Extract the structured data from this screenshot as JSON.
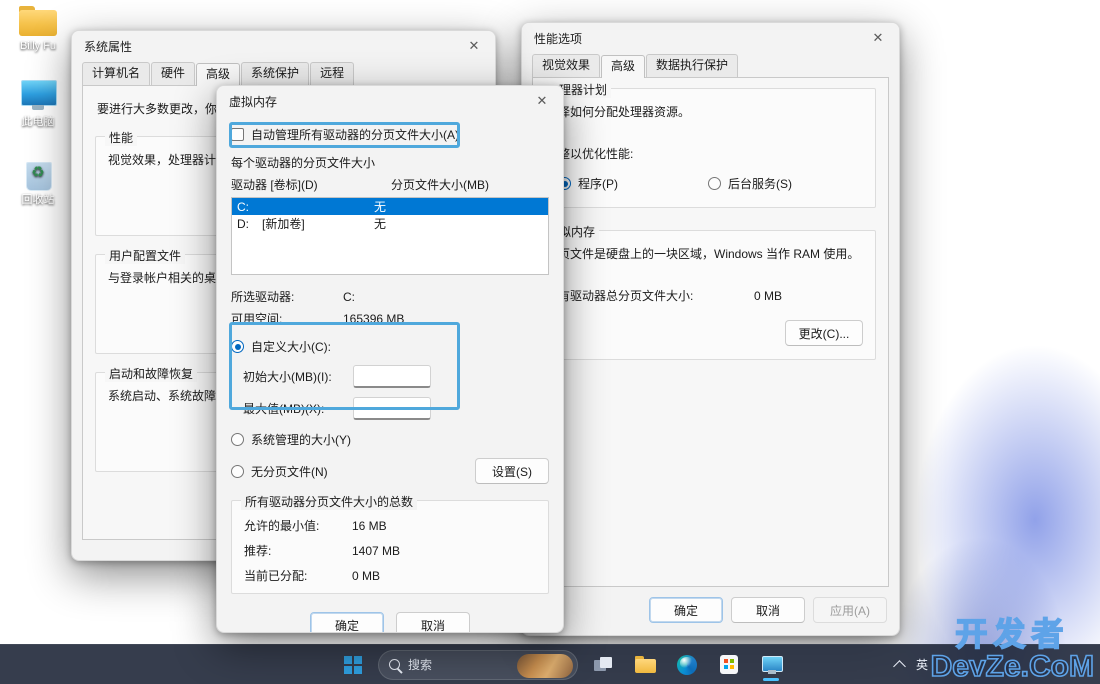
{
  "desktop": {
    "icons": [
      {
        "label": "Billy Fu",
        "icon": "folder-icon"
      },
      {
        "label": "此电脑",
        "icon": "this-pc-icon"
      },
      {
        "label": "回收站",
        "icon": "recycle-bin-icon"
      }
    ],
    "watermark_line1": "开发者",
    "watermark_line2": "DevZe.CoM"
  },
  "system_properties": {
    "title": "系统属性",
    "close_label": "✕",
    "tabs": [
      {
        "label": "计算机名",
        "active": false
      },
      {
        "label": "硬件",
        "active": false
      },
      {
        "label": "高级",
        "active": true
      },
      {
        "label": "系统保护",
        "active": false
      },
      {
        "label": "远程",
        "active": false
      }
    ],
    "intro": "要进行大多数更改，你必",
    "groups": [
      {
        "legend": "性能",
        "desc": "视觉效果，处理器计划，"
      },
      {
        "legend": "用户配置文件",
        "desc": "与登录帐户相关的桌面设"
      },
      {
        "legend": "启动和故障恢复",
        "desc": "系统启动、系统故障和调"
      }
    ]
  },
  "performance_options": {
    "title": "性能选项",
    "close_label": "✕",
    "tabs": [
      {
        "label": "视觉效果",
        "active": false
      },
      {
        "label": "高级",
        "active": true
      },
      {
        "label": "数据执行保护",
        "active": false
      }
    ],
    "processor_group": {
      "legend": "理器计划",
      "desc": "择如何分配处理器资源。",
      "adjust_label": "整以优化性能:",
      "radio_programs": "程序(P)",
      "radio_services": "后台服务(S)",
      "programs_selected": true,
      "services_selected": false
    },
    "virtual_memory_group": {
      "legend": "拟内存",
      "desc": "页文件是硬盘上的一块区域，Windows 当作 RAM 使用。",
      "total_label": "有驱动器总分页文件大小:",
      "total_value": "0 MB",
      "change_button": "更改(C)..."
    },
    "footer_buttons": [
      {
        "label": "确定",
        "style": "default",
        "disabled": false
      },
      {
        "label": "取消",
        "style": "normal",
        "disabled": false
      },
      {
        "label": "应用(A)",
        "style": "normal",
        "disabled": true
      }
    ]
  },
  "virtual_memory": {
    "title": "虚拟内存",
    "close_label": "✕",
    "auto_manage": {
      "label": "自动管理所有驱动器的分页文件大小(A)",
      "checked": false,
      "highlighted": true
    },
    "per_drive": {
      "legend": "每个驱动器的分页文件大小",
      "columns": [
        "驱动器 [卷标](D)",
        "分页文件大小(MB)"
      ],
      "rows": [
        {
          "drive": "C:",
          "volume": "",
          "size": "无",
          "selected": true
        },
        {
          "drive": "D:",
          "volume": "[新加卷]",
          "size": "无",
          "selected": false
        }
      ]
    },
    "selected_drive_label": "所选驱动器:",
    "selected_drive_value": "C:",
    "free_space_label": "可用空间:",
    "free_space_value": "165396 MB",
    "options": {
      "custom": {
        "label": "自定义大小(C):",
        "selected": true,
        "highlighted": true,
        "initial_label": "初始大小(MB)(I):",
        "initial_value": "",
        "max_label": "最大值(MB)(X):",
        "max_value": ""
      },
      "system_managed": {
        "label": "系统管理的大小(Y)",
        "selected": false
      },
      "none": {
        "label": "无分页文件(N)",
        "selected": false
      }
    },
    "set_button": "设置(S)",
    "totals": {
      "legend": "所有驱动器分页文件大小的总数",
      "min_label": "允许的最小值:",
      "min_value": "16 MB",
      "recommended_label": "推荐:",
      "recommended_value": "1407 MB",
      "current_label": "当前已分配:",
      "current_value": "0 MB"
    },
    "footer_buttons": [
      {
        "label": "确定",
        "style": "default"
      },
      {
        "label": "取消",
        "style": "normal"
      }
    ]
  },
  "taskbar": {
    "start_label": "start-button",
    "search_placeholder": "搜索",
    "items": [
      {
        "name": "task-view-button",
        "icon": "task-view-icon"
      },
      {
        "name": "file-explorer-button",
        "icon": "folder-icon"
      },
      {
        "name": "edge-button",
        "icon": "edge-icon"
      },
      {
        "name": "microsoft-store-button",
        "icon": "store-icon"
      },
      {
        "name": "system-properties-taskbar-button",
        "icon": "system-app-icon",
        "running": true
      }
    ],
    "tray": {
      "overflow_label": "^",
      "ime_label": "英"
    }
  },
  "colors": {
    "accent_highlight": "#4fa8dc",
    "selection_blue": "#0078d4",
    "radio_blue": "#0067c0",
    "taskbar_bg": "#1a2234",
    "desktop_bg": "#091120"
  }
}
